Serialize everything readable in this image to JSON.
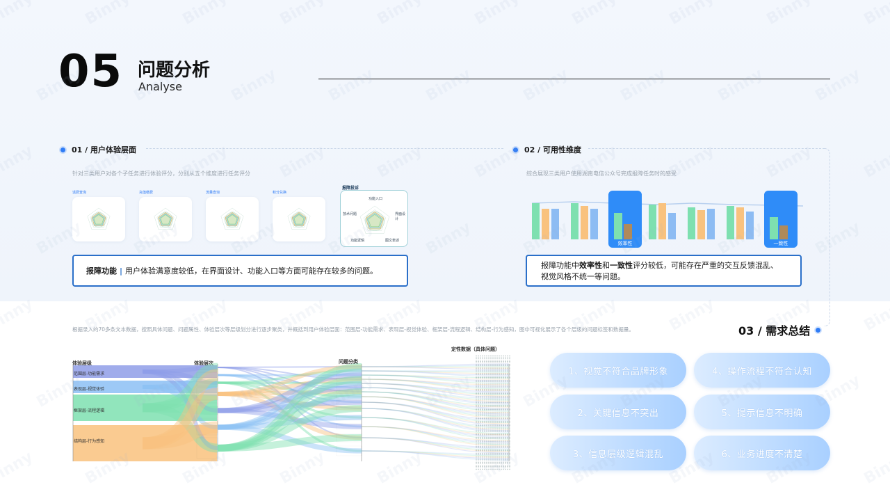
{
  "header": {
    "number": "05",
    "title": "问题分析",
    "subtitle": "Analyse"
  },
  "section1": {
    "title": "01 / 用户体验层面",
    "desc": "针对三类用户对各个子任务进行体验评分，分别从五个维度进行任务评分",
    "radars": [
      {
        "label": "话费查询"
      },
      {
        "label": "充值缴费"
      },
      {
        "label": "流量查询"
      },
      {
        "label": "积分兑换"
      }
    ],
    "radar_big": {
      "label": "报障投诉",
      "axes": [
        "功能入口",
        "界面设计",
        "图文表述",
        "功能逻辑",
        "技术问题"
      ]
    },
    "callout": {
      "bold": "报障功能",
      "sep": "|",
      "text": "用户体验满意度较低，在界面设计、功能入口等方面可能存在较多的问题。"
    }
  },
  "section2": {
    "title": "02 / 可用性维度",
    "desc": "综合展现三类用户使用湖南电信公众号完成报障任务时的感受",
    "groups": [
      {
        "label": "",
        "highlight": false
      },
      {
        "label": "",
        "highlight": false
      },
      {
        "label": "效率性",
        "highlight": true
      },
      {
        "label": "",
        "highlight": false
      },
      {
        "label": "",
        "highlight": false
      },
      {
        "label": "",
        "highlight": false
      },
      {
        "label": "一致性",
        "highlight": true
      }
    ],
    "callout": {
      "prefix": "报障功能中",
      "b1": "效率性",
      "mid": "和",
      "b2": "一致性",
      "suffix": "评分较低，可能存在严重的交互反馈混乱、",
      "line2": "视觉风格不统一等问题。"
    }
  },
  "section3": {
    "desc": "根据录入的70多条文本数据，按照具体问题、问题属性、体验层次等层级划分进行逐步聚类，并概括到用户体验层面：范围层-功能需求、表现层-视觉体验、框架层-流程逻辑、结构层-行为感知，图中可视化展示了各个层级的问题标签和数据量。",
    "cols": [
      "体验层级",
      "体验层次",
      "问题分类",
      "定性数据（具体问题）"
    ],
    "levels": [
      "范围层-功能需求",
      "表现层-视觉体验",
      "框架层-流程逻辑",
      "结构层-行为感知"
    ]
  },
  "needs": {
    "title": "03 / 需求总结",
    "items": [
      "1、视觉不符合品牌形象",
      "4、操作流程不符合认知",
      "2、关键信息不突出",
      "5、提示信息不明确",
      "3、信息层级逻辑混乱",
      "6、业务进度不清楚"
    ]
  },
  "colors": {
    "accent": "#2f7cf6",
    "border": "#2a6fc9",
    "green": "#7ee0b0",
    "orange": "#f9c27e",
    "blue": "#8dbcf3",
    "purple": "#b7a6ee"
  }
}
